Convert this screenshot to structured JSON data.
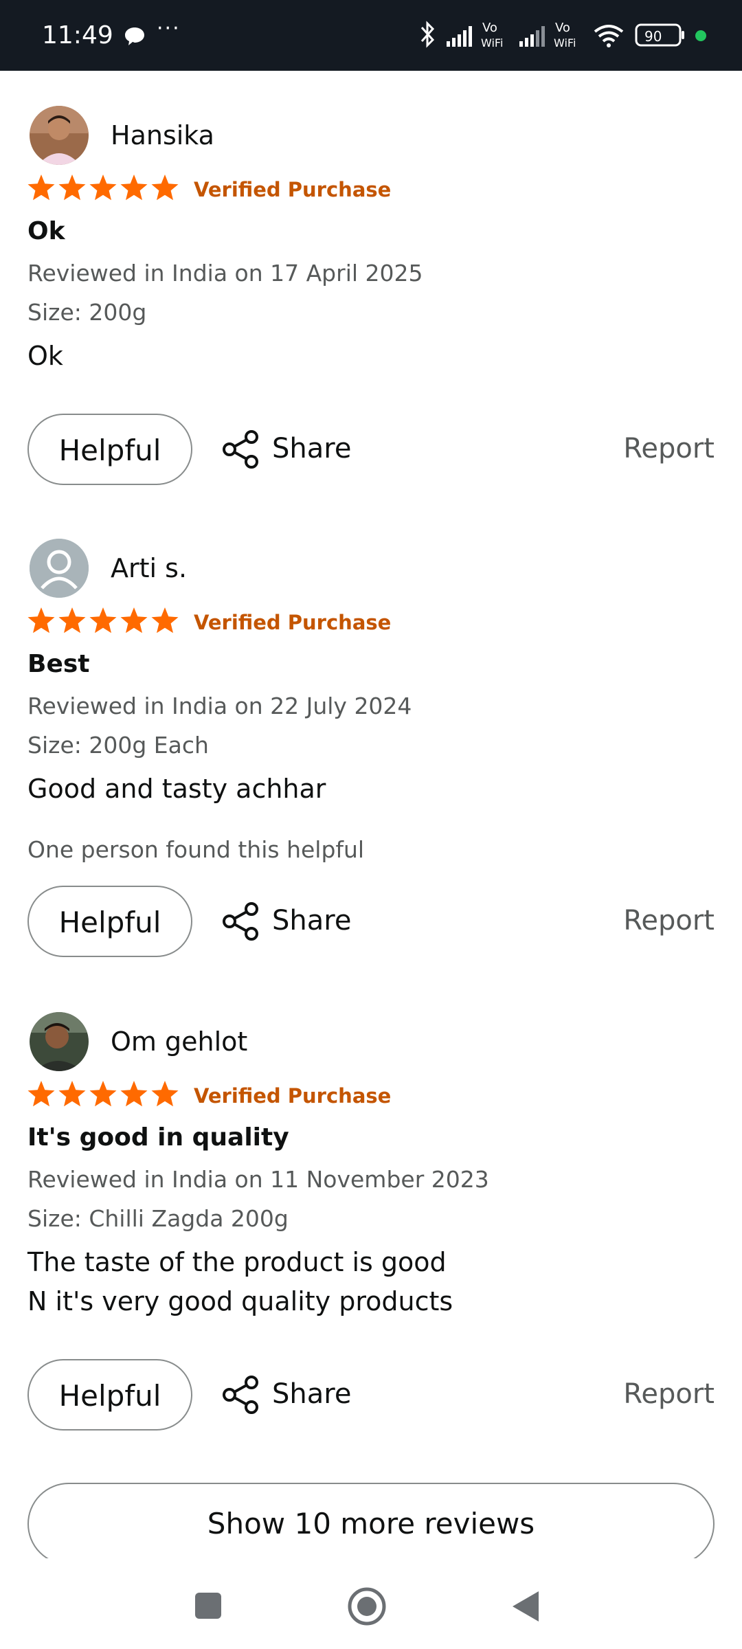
{
  "status_bar": {
    "time": "11:49",
    "more": "···",
    "battery": "90",
    "accent": "#22c55e"
  },
  "reviews": [
    {
      "name": "Hansika",
      "avatar": "photo",
      "stars": 5,
      "verified": "Verified Purchase",
      "title": "Ok",
      "date": "Reviewed in India on 17 April 2025",
      "size": "Size: 200g",
      "body": "Ok",
      "helpful_count": "",
      "helpful_label": "Helpful",
      "share_label": "Share",
      "report_label": "Report"
    },
    {
      "name": "Arti s.",
      "avatar": "placeholder",
      "stars": 5,
      "verified": "Verified Purchase",
      "title": "Best",
      "date": "Reviewed in India on 22 July 2024",
      "size": "Size: 200g Each",
      "body": "Good and tasty achhar",
      "helpful_count": "One person found this helpful",
      "helpful_label": "Helpful",
      "share_label": "Share",
      "report_label": "Report"
    },
    {
      "name": "Om gehlot",
      "avatar": "photo",
      "stars": 5,
      "verified": "Verified Purchase",
      "title": "It's good in quality",
      "date": "Reviewed in India on 11 November 2023",
      "size": "Size: Chilli Zagda 200g",
      "body": "The taste of the product is good\nN it's very good quality products",
      "helpful_count": "",
      "helpful_label": "Helpful",
      "share_label": "Share",
      "report_label": "Report"
    }
  ],
  "show_more": "Show 10 more reviews",
  "colors": {
    "star": "#ff6a00",
    "verified": "#c45500",
    "muted": "#565959"
  },
  "nav": {
    "icons": [
      "recents-square-icon",
      "home-circle-icon",
      "back-triangle-icon"
    ]
  }
}
